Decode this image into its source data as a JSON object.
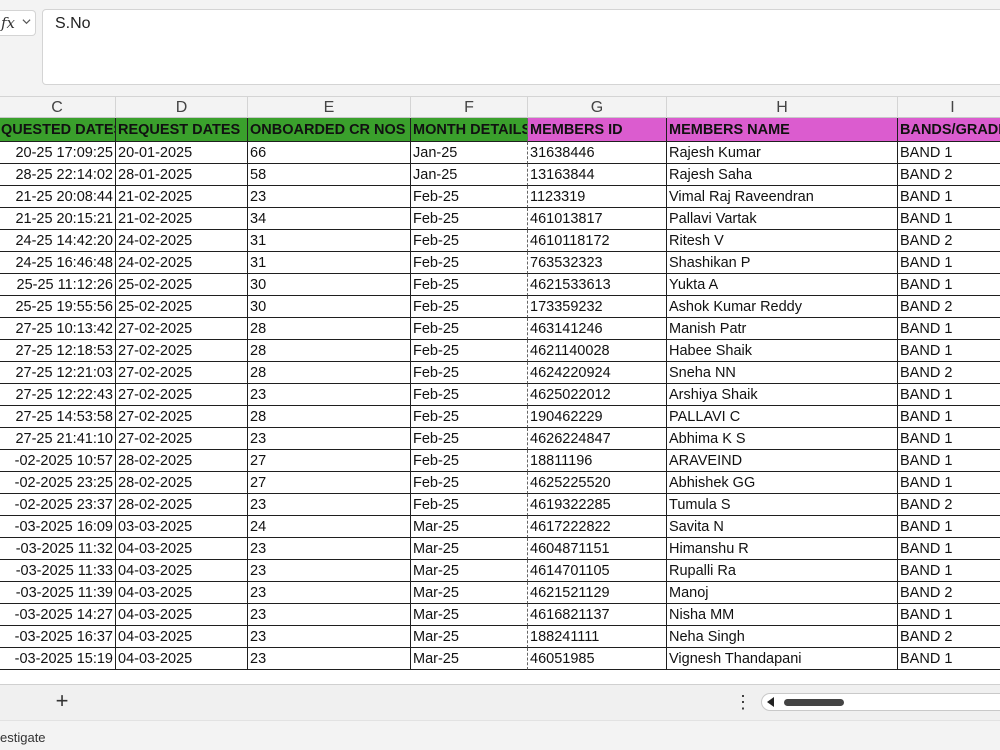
{
  "formula_bar": {
    "fx_label": "fx",
    "value": "S.No"
  },
  "column_headers": [
    "C",
    "D",
    "E",
    "F",
    "G",
    "H",
    "I"
  ],
  "table": {
    "headers": [
      "QUESTED DATES",
      "REQUEST DATES",
      "ONBOARDED CR NOS",
      "MONTH DETAILS",
      "MEMBERS ID",
      "MEMBERS NAME",
      "BANDS/GRADE"
    ],
    "header_colors": [
      "#3aa02c",
      "#3aa02c",
      "#3aa02c",
      "#3aa02c",
      "#db5ccf",
      "#db5ccf",
      "#db5ccf"
    ],
    "rows": [
      [
        "20-25 17:09:25",
        "20-01-2025",
        "66",
        "Jan-25",
        "31638446",
        "Rajesh Kumar",
        "BAND 1"
      ],
      [
        "28-25 22:14:02",
        "28-01-2025",
        "58",
        "Jan-25",
        "13163844",
        "Rajesh Saha",
        "BAND 2"
      ],
      [
        "21-25 20:08:44",
        "21-02-2025",
        "23",
        "Feb-25",
        "1123319",
        "Vimal Raj Raveendran",
        "BAND 1"
      ],
      [
        "21-25 20:15:21",
        "21-02-2025",
        "34",
        "Feb-25",
        "461013817",
        "Pallavi Vartak",
        "BAND 1"
      ],
      [
        "24-25 14:42:20",
        "24-02-2025",
        "31",
        "Feb-25",
        "4610118172",
        "Ritesh V",
        "BAND 2"
      ],
      [
        "24-25 16:46:48",
        "24-02-2025",
        "31",
        "Feb-25",
        "763532323",
        "Shashikan P",
        "BAND 1"
      ],
      [
        "25-25 11:12:26",
        "25-02-2025",
        "30",
        "Feb-25",
        "4621533613",
        "Yukta A",
        "BAND 1"
      ],
      [
        "25-25 19:55:56",
        "25-02-2025",
        "30",
        "Feb-25",
        "173359232",
        "Ashok Kumar Reddy",
        "BAND 2"
      ],
      [
        "27-25 10:13:42",
        "27-02-2025",
        "28",
        "Feb-25",
        "463141246",
        "Manish Patr",
        "BAND 1"
      ],
      [
        "27-25 12:18:53",
        "27-02-2025",
        "28",
        "Feb-25",
        "4621140028",
        "Habee  Shaik",
        "BAND 1"
      ],
      [
        "27-25 12:21:03",
        "27-02-2025",
        "28",
        "Feb-25",
        "4624220924",
        "Sneha NN",
        "BAND 2"
      ],
      [
        "27-25 12:22:43",
        "27-02-2025",
        "23",
        "Feb-25",
        "4625022012",
        "Arshiya  Shaik",
        "BAND 1"
      ],
      [
        "27-25 14:53:58",
        "27-02-2025",
        "28",
        "Feb-25",
        "190462229",
        "PALLAVI C",
        "BAND 1"
      ],
      [
        "27-25 21:41:10",
        "27-02-2025",
        "23",
        "Feb-25",
        "4626224847",
        "Abhima  K S",
        "BAND 1"
      ],
      [
        "-02-2025 10:57",
        "28-02-2025",
        "27",
        "Feb-25",
        "18811196",
        "ARAVEIND",
        "BAND 1"
      ],
      [
        "-02-2025 23:25",
        "28-02-2025",
        "27",
        "Feb-25",
        "4625225520",
        " Abhishek GG",
        "BAND 1"
      ],
      [
        "-02-2025 23:37",
        "28-02-2025",
        "23",
        "Feb-25",
        "4619322285",
        "Tumula S",
        "BAND 2"
      ],
      [
        "-03-2025 16:09",
        "03-03-2025",
        "24",
        "Mar-25",
        "4617222822",
        "Savita N",
        "BAND 1"
      ],
      [
        "-03-2025 11:32",
        "04-03-2025",
        "23",
        "Mar-25",
        "4604871151",
        "Himanshu R",
        "BAND 1"
      ],
      [
        "-03-2025 11:33",
        "04-03-2025",
        "23",
        "Mar-25",
        "4614701105",
        "Rupalli Ra",
        "BAND 1"
      ],
      [
        "-03-2025 11:39",
        "04-03-2025",
        "23",
        "Mar-25",
        "4621521129",
        "Manoj",
        "BAND 2"
      ],
      [
        "-03-2025 14:27",
        "04-03-2025",
        "23",
        "Mar-25",
        "4616821137",
        "Nisha MM",
        "BAND 1"
      ],
      [
        "-03-2025 16:37",
        "04-03-2025",
        "23",
        "Mar-25",
        "188241111",
        "Neha Singh",
        "BAND 2"
      ],
      [
        "-03-2025 15:19",
        "04-03-2025",
        "23",
        "Mar-25",
        "46051985",
        "Vignesh Thandapani",
        "BAND 1"
      ]
    ]
  },
  "sheet_bar": {
    "add_sheet_label": "+",
    "more_label": "⋮"
  },
  "status_bar": {
    "text": "estigate"
  }
}
